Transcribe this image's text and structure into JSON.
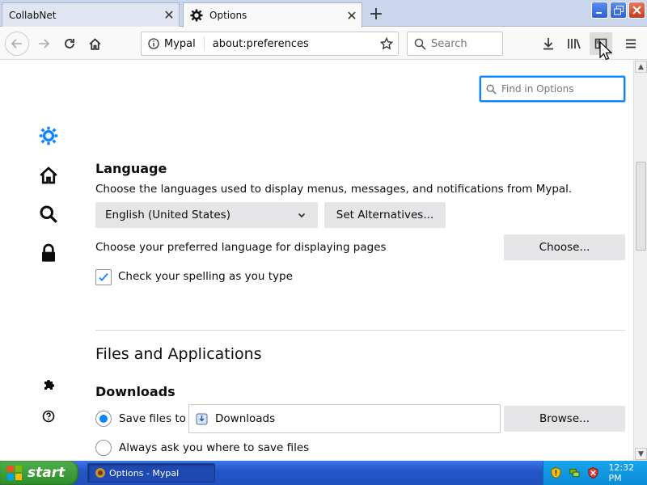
{
  "tabs": {
    "inactive_title": "CollabNet",
    "active_title": "Options"
  },
  "nav": {
    "identity_label": "Mypal",
    "url": "about:preferences",
    "search_placeholder": "Search"
  },
  "content": {
    "find_placeholder": "Find in Options",
    "language_heading": "Language",
    "language_desc": "Choose the languages used to display menus, messages, and notifications from Mypal.",
    "language_select_value": "English (United States)",
    "set_alternatives_label": "Set Alternatives...",
    "pref_lang_desc": "Choose your preferred language for displaying pages",
    "choose_label": "Choose...",
    "spell_check_label": "Check your spelling as you type",
    "spell_check_checked": true,
    "files_heading": "Files and Applications",
    "downloads_heading": "Downloads",
    "save_files_label": "Save files to",
    "download_folder": "Downloads",
    "browse_label": "Browse...",
    "always_ask_label": "Always ask you where to save files"
  },
  "taskbar": {
    "start_label": "start",
    "task_item_label": "Options - Mypal",
    "clock": "12:32 PM"
  },
  "colors": {
    "accent": "#0a84ff",
    "button_bg": "#e5e5e7",
    "taskbar_blue": "#2456c8",
    "start_green": "#3a9a35"
  }
}
